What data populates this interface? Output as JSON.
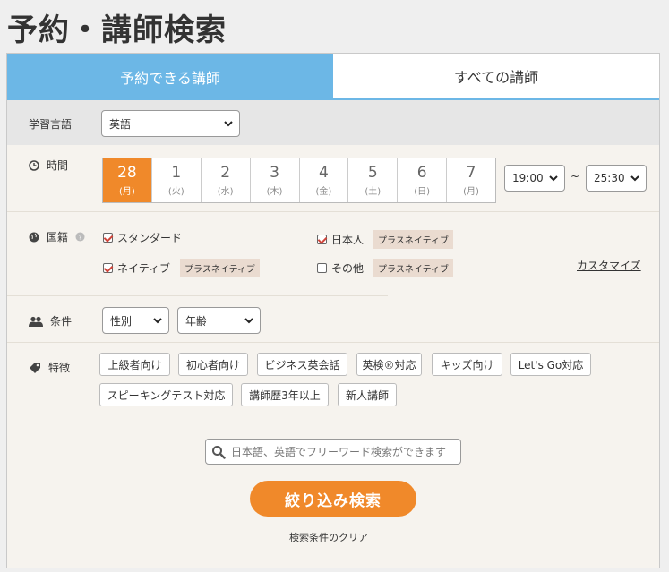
{
  "page_title": "予約・講師検索",
  "tabs": [
    "予約できる講師",
    "すべての講師"
  ],
  "language": {
    "label": "学習言語",
    "value": "英語"
  },
  "time": {
    "label": "時間",
    "days": [
      {
        "n": "28",
        "w": "(月)"
      },
      {
        "n": "1",
        "w": "(火)"
      },
      {
        "n": "2",
        "w": "(水)"
      },
      {
        "n": "3",
        "w": "(木)"
      },
      {
        "n": "4",
        "w": "(金)"
      },
      {
        "n": "5",
        "w": "(土)"
      },
      {
        "n": "6",
        "w": "(日)"
      },
      {
        "n": "7",
        "w": "(月)"
      }
    ],
    "selected_day": "28",
    "from": "19:00",
    "tilde": "~",
    "to": "25:30"
  },
  "nationality": {
    "label": "国籍",
    "options": [
      {
        "text": "スタンダード",
        "checked": true,
        "tag": ""
      },
      {
        "text": "日本人",
        "checked": true,
        "tag": "プラスネイティブ"
      },
      {
        "text": "ネイティブ",
        "checked": true,
        "tag": "プラスネイティブ"
      },
      {
        "text": "その他",
        "checked": false,
        "tag": "プラスネイティブ"
      }
    ],
    "customize": "カスタマイズ"
  },
  "conditions": {
    "label": "条件",
    "gender": "性別",
    "age": "年齢"
  },
  "features": {
    "label": "特徴",
    "tags": [
      "上級者向け",
      "初心者向け",
      "ビジネス英会話",
      "英検®対応",
      "キッズ向け",
      "Let's Go対応",
      "スピーキングテスト対応",
      "講師歴3年以上",
      "新人講師"
    ]
  },
  "search": {
    "placeholder": "日本語、英語でフリーワード検索ができます"
  },
  "submit": "絞り込み検索",
  "clear": "検索条件のクリア",
  "colors": {
    "accent": "#f0892a",
    "tab_active": "#6cb7e6"
  }
}
